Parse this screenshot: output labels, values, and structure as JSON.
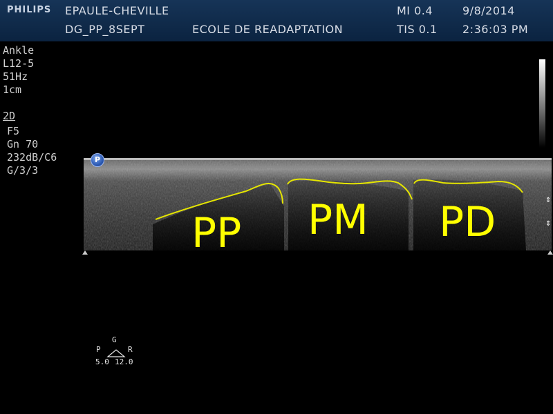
{
  "header": {
    "brand": "PHILIPS",
    "exam": "EPAULE-CHEVILLE",
    "patient_id": "DG_PP_8SEPT",
    "institution": "ECOLE DE READAPTATION",
    "mi": "MI 0.4",
    "tis": "TIS 0.1",
    "date": "9/8/2014",
    "time": "2:36:03 PM"
  },
  "params": {
    "preset": "Ankle",
    "probe": "L12-5",
    "frame_rate": "51Hz",
    "depth": "1cm",
    "mode": "2D",
    "focus": "F5",
    "gain": "Gn 70",
    "dynamic": "232dB/C6",
    "gsettings": "G/3/3"
  },
  "image": {
    "marker": "P",
    "outline_color": "#e6e600",
    "labels": {
      "pp": "PP",
      "pm": "PM",
      "pd": "PD"
    }
  },
  "compound": {
    "g_label": "G",
    "p_label": "P",
    "r_label": "R",
    "p_value": "5.0",
    "r_value": "12.0"
  }
}
